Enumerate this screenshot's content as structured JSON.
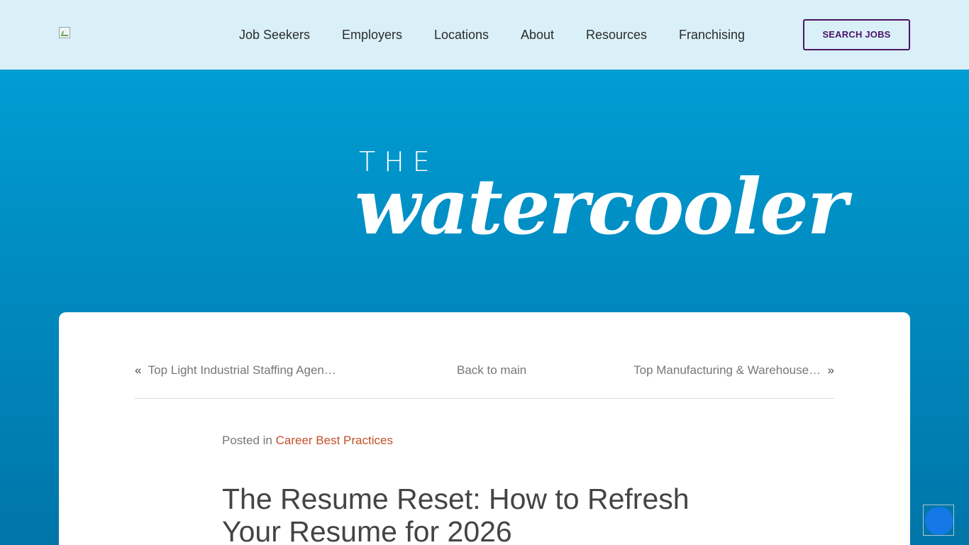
{
  "header": {
    "nav": [
      {
        "label": "Job Seekers"
      },
      {
        "label": "Employers"
      },
      {
        "label": "Locations"
      },
      {
        "label": "About"
      },
      {
        "label": "Resources"
      },
      {
        "label": "Franchising"
      }
    ],
    "cta_label": "SEARCH JOBS"
  },
  "hero": {
    "the": "THE",
    "script": "watercooler"
  },
  "post_nav": {
    "prev_arrow": "«",
    "prev_label": "Top Light Industrial Staffing Agen…",
    "back_label": "Back to main",
    "next_label": "Top Manufacturing & Warehouse…",
    "next_arrow": "»"
  },
  "post": {
    "posted_in": "Posted in",
    "category": "Career Best Practices",
    "title": "The Resume Reset: How to Refresh Your Resume for 2026"
  },
  "colors": {
    "header_bg": "#daf0f9",
    "hero_top": "#00a4d9",
    "hero_bottom": "#0075a8",
    "cta_border": "#4b1466",
    "category_link": "#c2512a",
    "widget": "#1478e6"
  }
}
